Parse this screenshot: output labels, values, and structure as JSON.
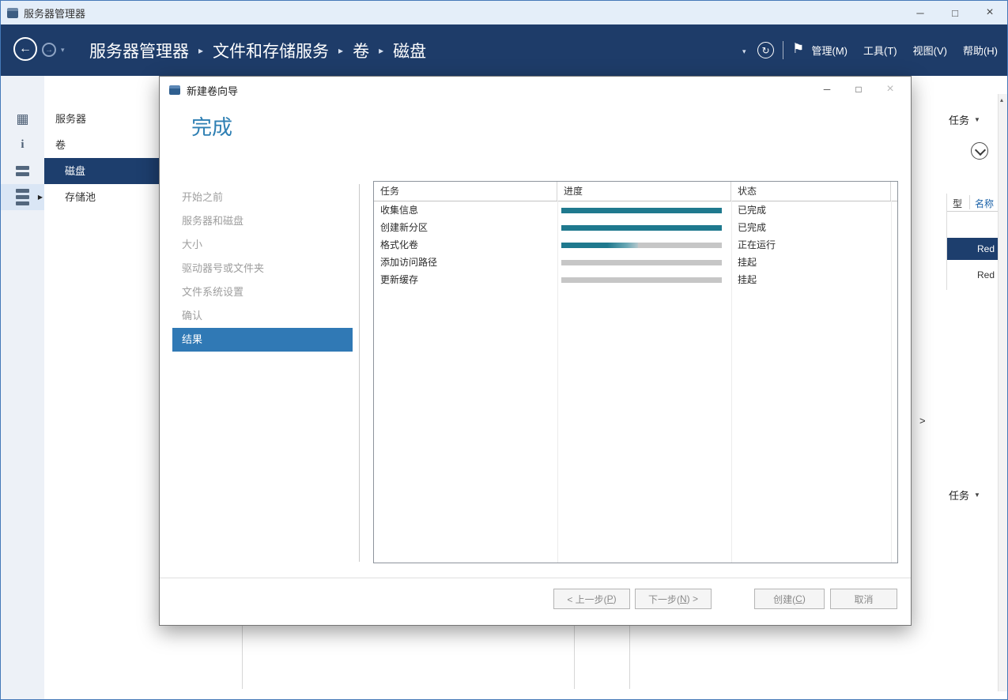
{
  "colors": {
    "navbar_bg": "#1e3c69",
    "selection_navy": "#1d3e6d",
    "step_highlight_blue": "#3079b5",
    "progress_teal": "#1f798e",
    "heading_blue": "#2e7fb3",
    "link_blue": "#1b62a8"
  },
  "window": {
    "title": "服务器管理器",
    "controls": {
      "minimize": "─",
      "maximize": "□",
      "close": "×"
    }
  },
  "navbar": {
    "back_glyph": "←",
    "forward_glyph": "→",
    "history_caret": "▾",
    "breadcrumb": [
      {
        "label": "服务器管理器"
      },
      {
        "label": "文件和存储服务"
      },
      {
        "label": "卷"
      },
      {
        "label": "磁盘"
      }
    ],
    "separator": "▸",
    "breadcrumb_caret": "▾",
    "refresh_glyph": "↻",
    "flag_glyph": "⚑",
    "menus": [
      {
        "label": "管理(M)"
      },
      {
        "label": "工具(T)"
      },
      {
        "label": "视图(V)"
      },
      {
        "label": "帮助(H)"
      }
    ]
  },
  "rail": {
    "dashboard_glyph": "▦",
    "local_server_glyph": "i",
    "flyout_glyph": "▶"
  },
  "sidebar": {
    "items": [
      {
        "label": "服务器",
        "selected": false
      },
      {
        "label": "卷",
        "selected": false
      },
      {
        "label": "磁盘",
        "selected": true
      },
      {
        "label": "存储池",
        "selected": false
      }
    ]
  },
  "wizard": {
    "title": "新建卷向导",
    "controls": {
      "minimize": "─",
      "maximize": "□",
      "close": "×"
    },
    "page_title": "完成",
    "steps": [
      {
        "label": "开始之前",
        "state": "inactive"
      },
      {
        "label": "服务器和磁盘",
        "state": "inactive"
      },
      {
        "label": "大小",
        "state": "inactive"
      },
      {
        "label": "驱动器号或文件夹",
        "state": "inactive"
      },
      {
        "label": "文件系统设置",
        "state": "inactive"
      },
      {
        "label": "确认",
        "state": "inactive"
      },
      {
        "label": "结果",
        "state": "selected"
      }
    ],
    "task_table": {
      "columns": [
        {
          "label": "任务"
        },
        {
          "label": "进度"
        },
        {
          "label": "状态"
        }
      ],
      "rows": [
        {
          "task": "收集信息",
          "progress_percent": 100,
          "state": "done",
          "status": "已完成"
        },
        {
          "task": "创建新分区",
          "progress_percent": 100,
          "state": "done",
          "status": "已完成"
        },
        {
          "task": "格式化卷",
          "progress_percent": 48,
          "state": "running",
          "status": "正在运行"
        },
        {
          "task": "添加访问路径",
          "progress_percent": 0,
          "state": "pending",
          "status": "挂起"
        },
        {
          "task": "更新缓存",
          "progress_percent": 0,
          "state": "pending",
          "status": "挂起"
        }
      ]
    },
    "buttons": [
      {
        "pre": "< 上一步(",
        "key": "P",
        "post": ")",
        "disabled": true
      },
      {
        "pre": "下一步(",
        "key": "N",
        "post": ") >",
        "disabled": true
      },
      {
        "pre": "创建(",
        "key": "C",
        "post": ")",
        "disabled": true
      },
      {
        "pre": "取消",
        "key": "",
        "post": "",
        "disabled": true
      }
    ]
  },
  "right_panel": {
    "tasks_top_label": "任务",
    "tasks_caret": "▼",
    "columns": [
      {
        "label": "型"
      },
      {
        "label": "名称"
      }
    ],
    "rows": [
      {
        "label": "Red",
        "selected": true
      },
      {
        "label": "Red",
        "selected": false
      }
    ],
    "more_link": ">",
    "tasks_bottom_label": "任务"
  },
  "scrollbar": {
    "up_glyph": "▴"
  }
}
